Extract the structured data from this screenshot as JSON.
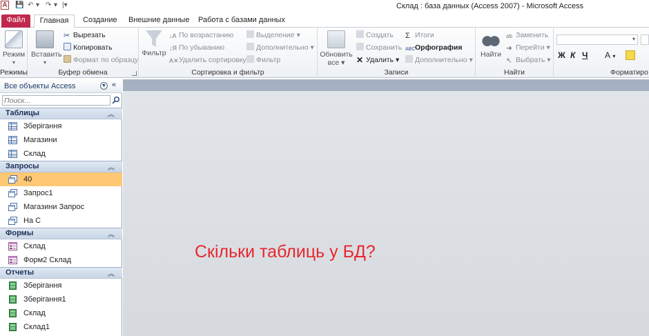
{
  "window": {
    "title": "Склад : база данных (Access 2007)  -  Microsoft Access",
    "app_icon_letter": "A"
  },
  "tabs": [
    "Файл",
    "Главная",
    "Создание",
    "Внешние данные",
    "Работа с базами данных"
  ],
  "ribbon": {
    "modes": {
      "label": "Режимы",
      "view_button": "Режим"
    },
    "clipboard": {
      "label": "Буфер обмена",
      "paste": "Вставить",
      "cut": "Вырезать",
      "copy": "Копировать",
      "format_painter": "Формат по образцу"
    },
    "sort_filter": {
      "label": "Сортировка и фильтр",
      "filter": "Фильтр",
      "ascending": "По возрастанию",
      "descending": "По убыванию",
      "remove_sort": "Удалить сортировку",
      "selection": "Выделение",
      "advanced": "Дополнительно",
      "toggle_filter": "Фильтр"
    },
    "records": {
      "label": "Записи",
      "refresh_line1": "Обновить",
      "refresh_line2": "все",
      "new": "Создать",
      "save": "Сохранить",
      "delete": "Удалить",
      "totals": "Итоги",
      "spelling": "Орфография",
      "more": "Дополнительно"
    },
    "find": {
      "label": "Найти",
      "find": "Найти",
      "replace": "Заменить",
      "goto": "Перейти",
      "select": "Выбрать"
    },
    "formatting": {
      "label": "Форматиро",
      "bold": "Ж",
      "italic": "К",
      "underline": "Ч",
      "font_color": "А"
    }
  },
  "nav_pane": {
    "title": "Все объекты Access",
    "search_placeholder": "Поиск...",
    "sections": [
      {
        "title": "Таблицы",
        "items": [
          "Зберігання",
          "Магазини",
          "Склад"
        ]
      },
      {
        "title": "Запросы",
        "items": [
          "40",
          "Запрос1",
          "Магазини Запрос",
          "На С"
        ],
        "selected_item": "40"
      },
      {
        "title": "Формы",
        "items": [
          "Склад",
          "Форм2 Склад"
        ]
      },
      {
        "title": "Отчеты",
        "items": [
          "Зберігання",
          "Зберігання1",
          "Склад",
          "Склад1"
        ]
      }
    ]
  },
  "workspace": {
    "overlay_text": "Скільки таблиць у БД?"
  },
  "colors": {
    "file_tab": "#c0284d",
    "selected_item": "#ffc875",
    "overlay_text": "#e8262e"
  }
}
